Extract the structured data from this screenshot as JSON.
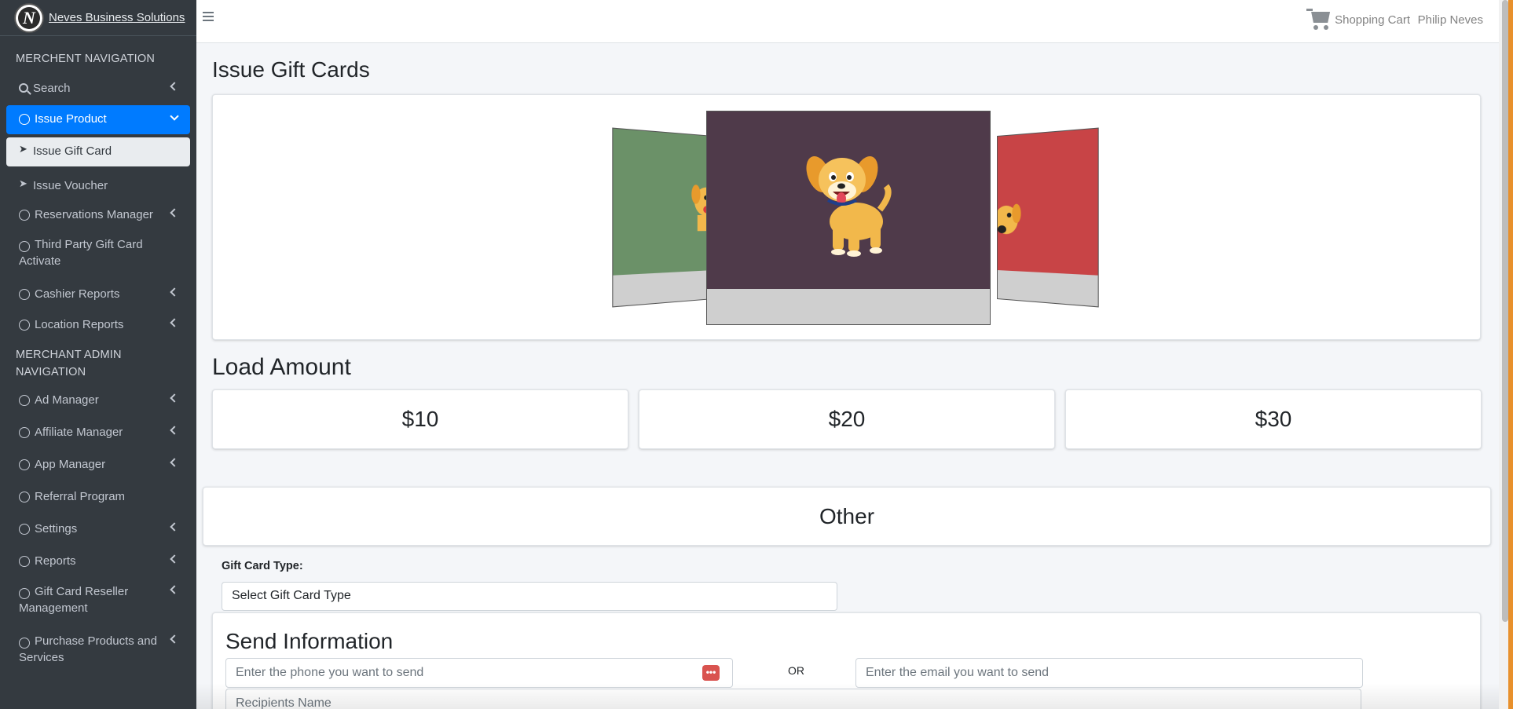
{
  "brand": {
    "name": "Neves Business Solutions",
    "logo_letter": "N"
  },
  "sidebar": {
    "merchant_header": "MERCHENT NAVIGATION",
    "admin_header": "MERCHANT ADMIN NAVIGATION",
    "items": [
      {
        "label": "Search"
      },
      {
        "label": "Issue Product"
      },
      {
        "label": "Issue Gift Card"
      },
      {
        "label": "Issue Voucher"
      },
      {
        "label": "Reservations Manager"
      },
      {
        "label": "Third Party Gift Card Activate"
      },
      {
        "label": "Cashier Reports"
      },
      {
        "label": "Location Reports"
      }
    ],
    "admin_items": [
      {
        "label": "Ad Manager"
      },
      {
        "label": "Affiliate Manager"
      },
      {
        "label": "App Manager"
      },
      {
        "label": "Referral Program"
      },
      {
        "label": "Settings"
      },
      {
        "label": "Reports"
      },
      {
        "label": "Gift Card Reseller Management"
      },
      {
        "label": "Purchase Products and Services"
      }
    ]
  },
  "topbar": {
    "cart_label": "Shopping Cart",
    "user_name": "Philip Neves"
  },
  "main": {
    "title": "Issue Gift Cards",
    "load_amount_title": "Load Amount",
    "amounts": [
      "$10",
      "$20",
      "$30"
    ],
    "other_label": "Other",
    "gift_card_type_label": "Gift Card Type:",
    "gift_card_type_value": "Select Gift Card Type",
    "send_title": "Send Information",
    "phone_placeholder": "Enter the phone you want to send",
    "or_label": "OR",
    "email_placeholder": "Enter the email you want to send",
    "recipient_placeholder": "Recipients Name",
    "cards": [
      {
        "color": "#6b9168"
      },
      {
        "color": "#4f3a4a"
      },
      {
        "color": "#c84446"
      }
    ]
  },
  "colors": {
    "sidebar_bg": "#343a40",
    "accent": "#007bff",
    "danger": "#d9534f"
  }
}
